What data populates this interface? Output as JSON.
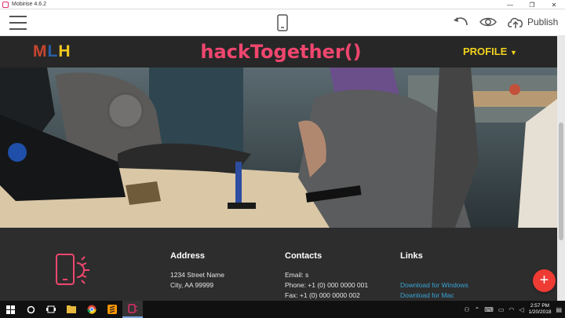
{
  "window": {
    "title": "Mobirise 4.6.2",
    "controls": [
      "—",
      "❐",
      "✕"
    ]
  },
  "toolbar": {
    "publish_label": "Publish",
    "icons": [
      "menu-icon",
      "mobile-preview-icon",
      "undo-icon",
      "preview-eye-icon",
      "cloud-upload-icon"
    ]
  },
  "site": {
    "logo": {
      "m": "M",
      "l": "L",
      "h": "H"
    },
    "brand_title": "hackTogether()",
    "profile_label": "PROFILE",
    "colors": {
      "brand": "#f0466e",
      "profile": "#f2d21f",
      "link": "#38a5d6",
      "fab": "#ee3b34"
    }
  },
  "footer": {
    "address": {
      "heading": "Address",
      "line1": "1234 Street Name",
      "line2": "City, AA 99999"
    },
    "contacts": {
      "heading": "Contacts",
      "email": "Email: s",
      "phone": "Phone: +1 (0) 000 0000 001",
      "fax": "Fax: +1 (0) 000 0000 002"
    },
    "links": {
      "heading": "Links",
      "windows": "Download for Windows",
      "mac": "Download for Mac"
    }
  },
  "fab_label": "+",
  "taskbar": {
    "time": "2:57 PM",
    "date": "1/20/2018"
  }
}
